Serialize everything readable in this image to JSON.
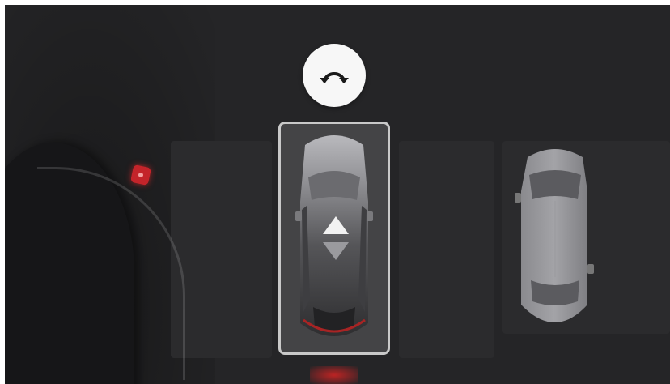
{
  "controls": {
    "rotate_icon": "rotate-arrow-icon",
    "shift_icon": "up-down-arrows-icon"
  },
  "alerts": {
    "sensor_icon": "proximity-sensor-icon",
    "sensor_color": "#c4242a"
  },
  "colors": {
    "background": "#252527",
    "selection_border": "#c9c9c9",
    "button_bg": "#f7f7f7"
  }
}
